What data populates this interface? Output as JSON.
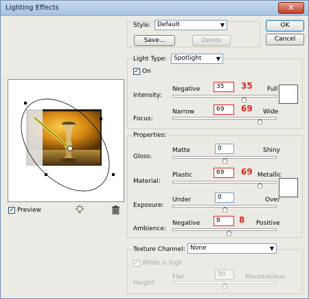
{
  "window": {
    "title": "Lighting Effects",
    "close_glyph": "✕"
  },
  "buttons": {
    "ok": "OK",
    "cancel": "Cancel",
    "save": "Save...",
    "delete": "Delete"
  },
  "style": {
    "label": "Style:",
    "value": "Default"
  },
  "light": {
    "type_label": "Light Type:",
    "type_value": "Spotlight",
    "on_label": "On",
    "on_checked": true,
    "intensity": {
      "label": "Intensity:",
      "min": "Negative",
      "max": "Full",
      "value": "35",
      "annotation": "35",
      "fraction": 0.69
    },
    "focus": {
      "label": "Focus:",
      "min": "Narrow",
      "max": "Wide",
      "value": "69",
      "annotation": "69",
      "fraction": 0.84
    }
  },
  "properties": {
    "title": "Properties:",
    "gloss": {
      "label": "Gloss:",
      "min": "Matte",
      "max": "Shiny",
      "value": "0",
      "fraction": 0.5
    },
    "material": {
      "label": "Material:",
      "min": "Plastic",
      "max": "Metallic",
      "value": "69",
      "annotation": "69",
      "fraction": 0.84
    },
    "exposure": {
      "label": "Exposure:",
      "min": "Under",
      "max": "Over",
      "value": "0",
      "fraction": 0.5
    },
    "ambience": {
      "label": "Ambience:",
      "min": "Negative",
      "max": "Positive",
      "value": "8",
      "annotation": "8",
      "fraction": 0.54
    }
  },
  "texture": {
    "label": "Texture Channel:",
    "value": "None",
    "white_is_high": "White is high",
    "height": {
      "label": "Height:",
      "min": "Flat",
      "max": "Mountainous",
      "value": "50",
      "fraction": 0.5
    }
  },
  "preview": {
    "label": "Preview",
    "checked": true
  },
  "colors": {
    "annotation": "#e0251f",
    "swatch": "#ffffff"
  },
  "icons": {
    "light_bulb": "light-bulb-icon",
    "trash": "trash-icon"
  }
}
